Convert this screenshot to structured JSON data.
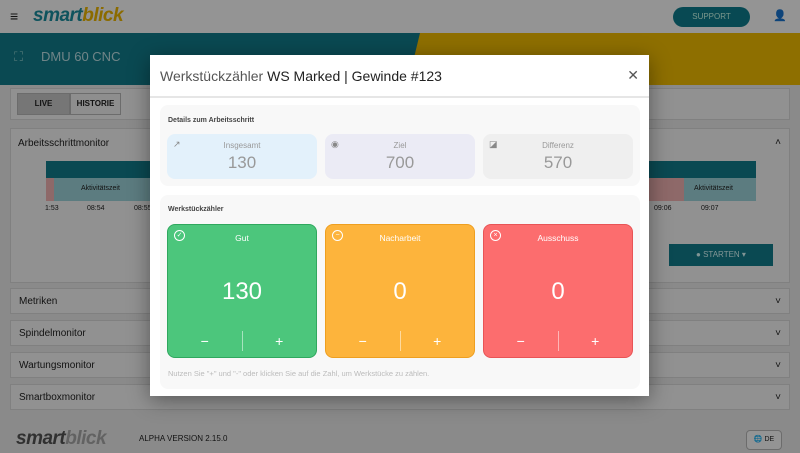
{
  "app": {
    "logo_a": "smart",
    "logo_b": "blick",
    "support": "SUPPORT",
    "machine": "DMU 60 CNC"
  },
  "toolbar": {
    "live": "LIVE",
    "historie": "HISTORIE"
  },
  "monitor": {
    "title": "Arbeitsschrittmonitor",
    "segment": "Aktivitätszeit",
    "ticks_left": [
      "1:53",
      "08:54",
      "08:55"
    ],
    "ticks_right": [
      "09:06",
      "09:07"
    ],
    "start": "STARTEN"
  },
  "sections": [
    {
      "label": "Metriken"
    },
    {
      "label": "Spindelmonitor"
    },
    {
      "label": "Wartungsmonitor"
    },
    {
      "label": "Smartboxmonitor"
    }
  ],
  "footer": {
    "version": "ALPHA VERSION 2.15.0",
    "lang": "DE"
  },
  "modal": {
    "title_prefix": "Werkstückzähler",
    "title_main": "WS Marked | Gewinde #123",
    "details_title": "Details zum Arbeitsschritt",
    "stats": [
      {
        "label": "Insgesamt",
        "value": "130",
        "icon": "trend-icon",
        "color": "#e3f1fb"
      },
      {
        "label": "Ziel",
        "value": "700",
        "icon": "target-icon",
        "color": "#ebebf5"
      },
      {
        "label": "Differenz",
        "value": "570",
        "icon": "difference-icon",
        "color": "#efefef"
      }
    ],
    "counter_title": "Werkstückzähler",
    "counters": [
      {
        "label": "Gut",
        "value": "130",
        "color": "#4cc67c"
      },
      {
        "label": "Nacharbeit",
        "value": "0",
        "color": "#fdb43c"
      },
      {
        "label": "Ausschuss",
        "value": "0",
        "color": "#fc6d6e"
      }
    ],
    "minus": "−",
    "plus": "+",
    "hint": "Nutzen Sie \"+\" und \"-\" oder klicken Sie auf die Zahl, um Werkstücke zu zählen."
  }
}
